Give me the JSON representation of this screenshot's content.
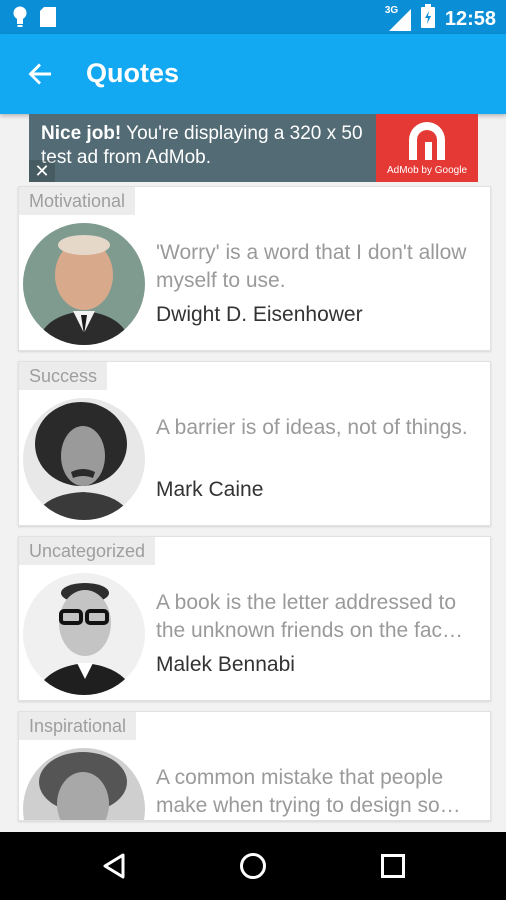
{
  "status_bar": {
    "icons_left": [
      "lightbulb-icon",
      "sd-card-icon"
    ],
    "signal_label": "3G",
    "time": "12:58"
  },
  "app_bar": {
    "title": "Quotes"
  },
  "ad": {
    "headline": "Nice job!",
    "body": " You're displaying a 320 x 50 test ad from AdMob.",
    "close_label": "✕",
    "brand": "AdMob by Google"
  },
  "quotes": [
    {
      "category": "Motivational",
      "quote": "'Worry' is a word that I don't allow myself to use.",
      "author": "Dwight D. Eisenhower"
    },
    {
      "category": "Success",
      "quote": "A barrier is of ideas, not of things.",
      "author": "Mark Caine"
    },
    {
      "category": "Uncategorized",
      "quote": "A book is the letter addressed to the unknown friends on the fac…",
      "author": "Malek Bennabi"
    },
    {
      "category": "Inspirational",
      "quote": "A common mistake that people make when trying to design so…",
      "author": ""
    }
  ],
  "colors": {
    "status_bar": "#0a8fd6",
    "app_bar": "#12a9f2",
    "ad_background": "#536b74",
    "ad_logo": "#e53935"
  }
}
